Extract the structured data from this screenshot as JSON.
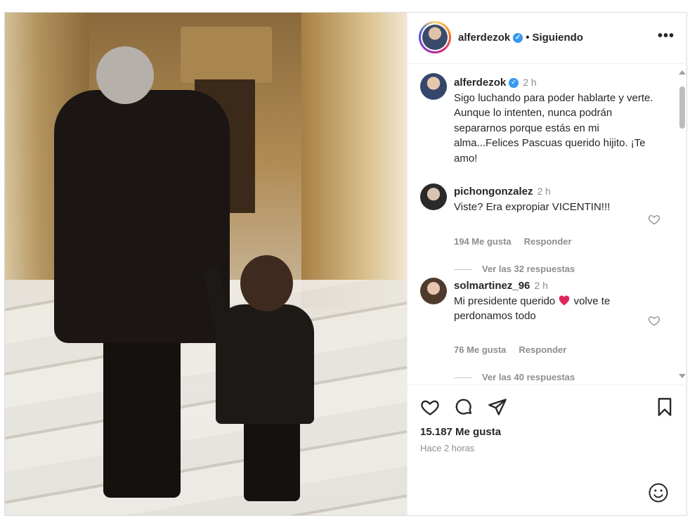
{
  "header": {
    "username": "alferdezok",
    "separator": "•",
    "follow_status": "Siguiendo",
    "more_icon": "more-horizontal-icon"
  },
  "caption": {
    "username": "alferdezok",
    "time": "2 h",
    "text": "Sigo luchando para poder hablarte y verte. Aunque lo intenten, nunca podrán separarnos porque estás en mi alma...Felices Pascuas querido hijito. ¡Te amo!"
  },
  "comments": [
    {
      "username": "pichongonzalez",
      "time": "2 h",
      "text": "Viste? Era expropiar VICENTIN!!!",
      "likes": "194 Me gusta",
      "reply": "Responder",
      "view_replies": "Ver las 32 respuestas"
    },
    {
      "username": "solmartinez_96",
      "time": "2 h",
      "text_before": "Mi presidente querido ",
      "text_after": " volve te perdonamos todo",
      "likes": "76 Me gusta",
      "reply": "Responder",
      "view_replies": "Ver las 40 respuestas"
    }
  ],
  "footer": {
    "likes": "15.187 Me gusta",
    "time_ago": "Hace 2 horas"
  },
  "colors": {
    "verified": "#3897f0",
    "muted": "#8e8e8e",
    "text": "#262626",
    "heart_emoji": "#e0245e"
  }
}
